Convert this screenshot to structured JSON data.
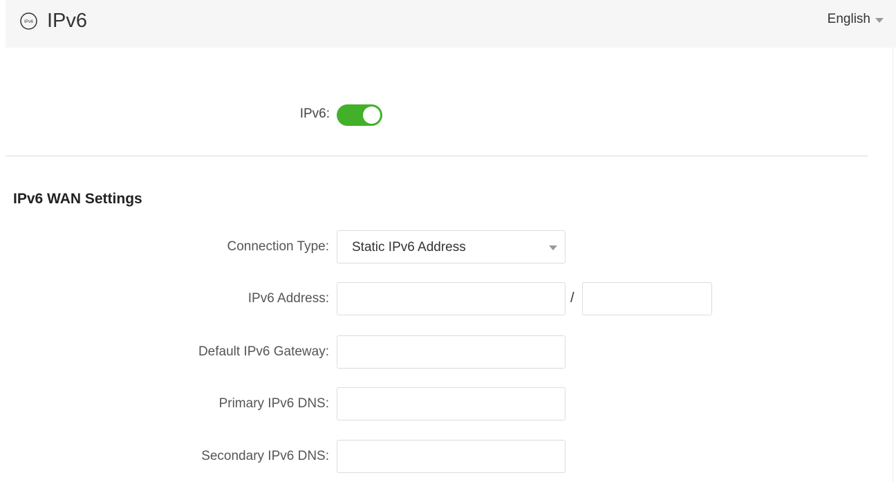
{
  "header": {
    "title": "IPv6",
    "logo_text": "IPv6",
    "language": "English"
  },
  "ipv6_toggle": {
    "label": "IPv6:",
    "enabled": true
  },
  "wan_settings": {
    "section_title": "IPv6 WAN Settings",
    "connection_type": {
      "label": "Connection Type:",
      "value": "Static IPv6 Address"
    },
    "ipv6_address": {
      "label": "IPv6 Address:",
      "address_value": "",
      "separator": "/",
      "prefix_value": ""
    },
    "default_gateway": {
      "label": "Default IPv6 Gateway:",
      "value": ""
    },
    "primary_dns": {
      "label": "Primary IPv6 DNS:",
      "value": ""
    },
    "secondary_dns": {
      "label": "Secondary IPv6 DNS:",
      "value": ""
    }
  },
  "colors": {
    "toggle_on": "#43b02a",
    "header_bg": "#f6f6f6",
    "border": "#dcdcdc"
  }
}
